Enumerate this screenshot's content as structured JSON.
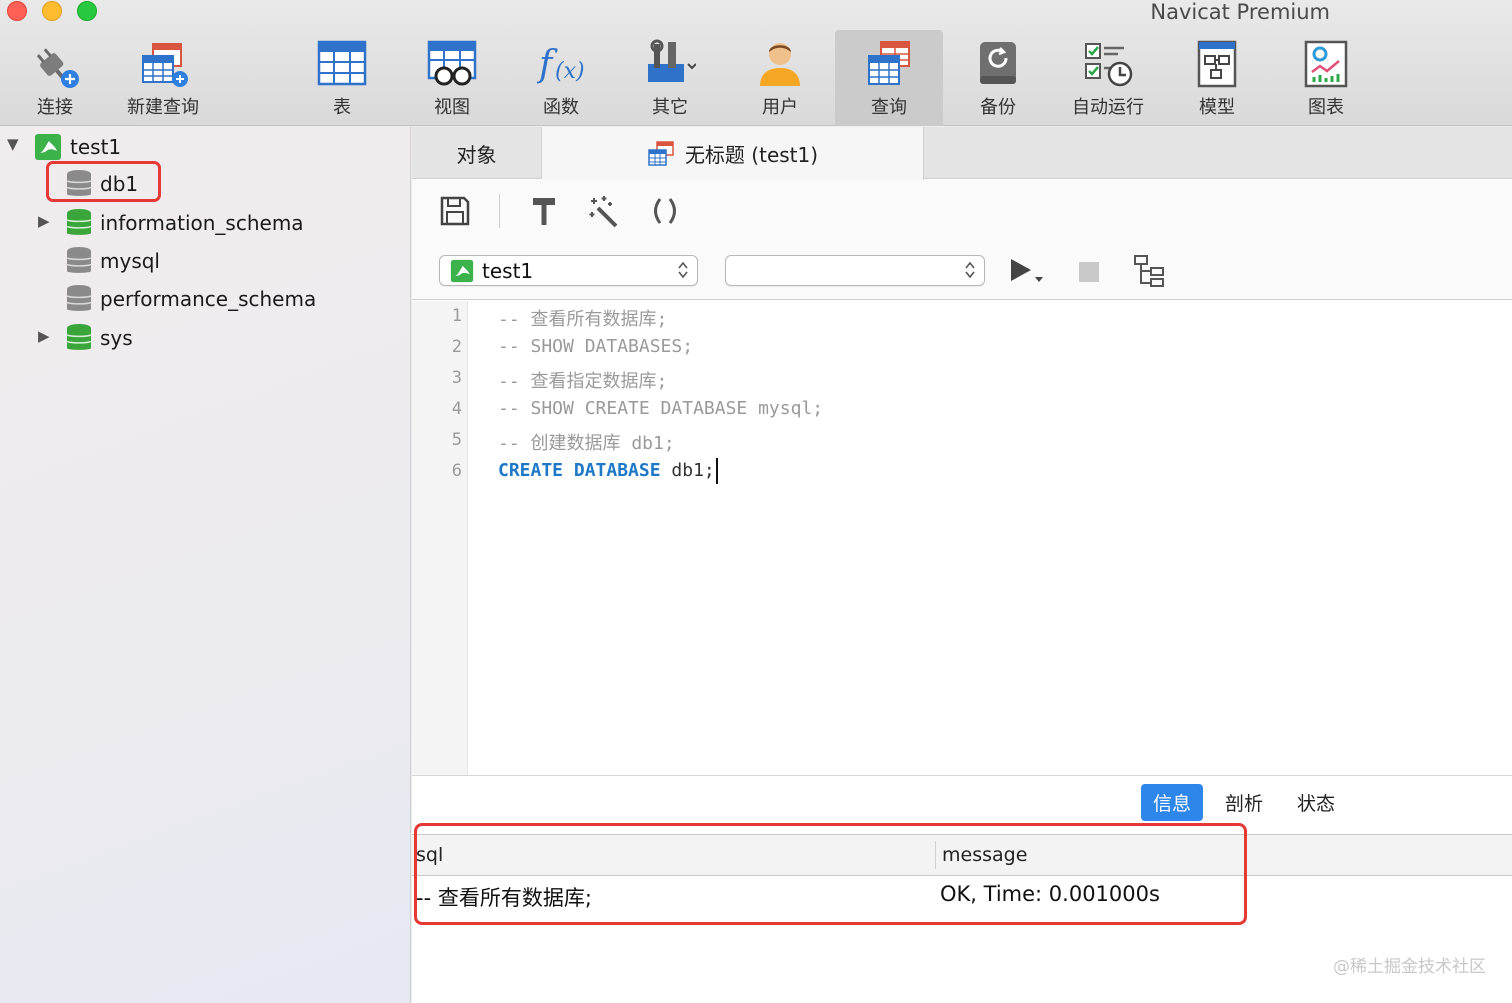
{
  "window": {
    "title": "Navicat Premium"
  },
  "toolbar": {
    "items": [
      {
        "label": "连接",
        "icon": "connection-plug-icon"
      },
      {
        "label": "新建查询",
        "icon": "new-query-icon"
      },
      {
        "label": "表",
        "icon": "table-icon"
      },
      {
        "label": "视图",
        "icon": "view-icon"
      },
      {
        "label": "函数",
        "icon": "function-icon"
      },
      {
        "label": "其它",
        "icon": "tools-icon"
      },
      {
        "label": "用户",
        "icon": "user-icon"
      },
      {
        "label": "查询",
        "icon": "query-icon",
        "active": true
      },
      {
        "label": "备份",
        "icon": "backup-icon"
      },
      {
        "label": "自动运行",
        "icon": "automation-icon"
      },
      {
        "label": "模型",
        "icon": "model-icon"
      },
      {
        "label": "图表",
        "icon": "chart-icon"
      }
    ]
  },
  "sidebar": {
    "connection": {
      "name": "test1",
      "expanded": true
    },
    "databases": [
      {
        "name": "db1",
        "highlighted": true,
        "expandable": false,
        "active": false
      },
      {
        "name": "information_schema",
        "expandable": true,
        "active": true
      },
      {
        "name": "mysql",
        "expandable": false,
        "active": false
      },
      {
        "name": "performance_schema",
        "expandable": false,
        "active": false
      },
      {
        "name": "sys",
        "expandable": true,
        "active": true
      }
    ]
  },
  "tabs": {
    "objects_label": "对象",
    "query_label": "无标题 (test1)"
  },
  "query_toolbar": {
    "connection_value": "test1",
    "database_value": ""
  },
  "editor": {
    "lines": [
      {
        "number": "1",
        "text": "-- 查看所有数据库;"
      },
      {
        "number": "2",
        "text": "-- SHOW DATABASES;"
      },
      {
        "number": "3",
        "text": "-- 查看指定数据库;"
      },
      {
        "number": "4",
        "text": "-- SHOW CREATE DATABASE mysql;"
      },
      {
        "number": "5",
        "text": "-- 创建数据库 db1;"
      },
      {
        "number": "6",
        "kw1": "CREATE",
        "kw2": "DATABASE",
        "rest": "db1;"
      }
    ]
  },
  "results": {
    "tabs": [
      "信息",
      "剖析",
      "状态"
    ],
    "active_tab": "信息",
    "columns": [
      "sql",
      "message"
    ],
    "rows": [
      {
        "sql": "-- 查看所有数据库;",
        "message": "OK, Time: 0.001000s"
      }
    ]
  },
  "watermark": "@稀土掘金技术社区",
  "colors": {
    "accent": "#2f86ea",
    "highlight": "#e53935",
    "keyword": "#1e78c8",
    "db_active": "#3aa53a",
    "db_inactive": "#8a8a8a"
  }
}
